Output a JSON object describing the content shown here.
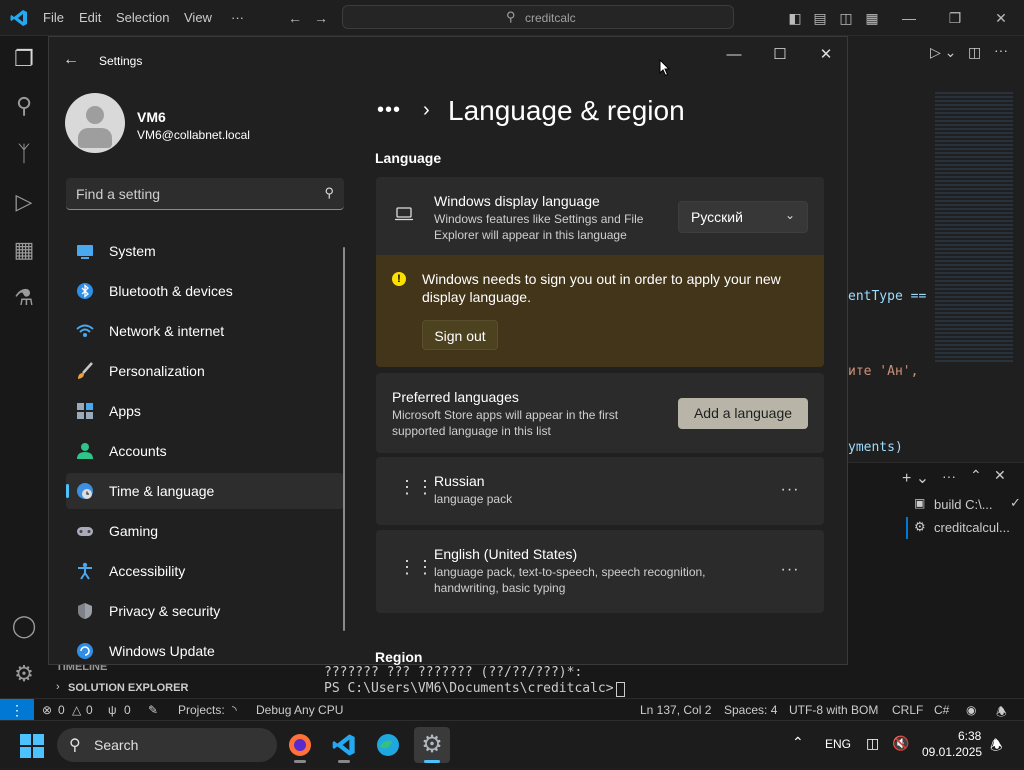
{
  "vscode": {
    "menu": [
      "File",
      "Edit",
      "Selection",
      "View",
      "···"
    ],
    "search": "creditcalc",
    "code_fragments": [
      "entType ==",
      "ите 'Aн',",
      "yments)"
    ],
    "terminal_tabs": [
      "build C:\\...",
      "creditcalcul..."
    ],
    "sidebar_sections": [
      "TIMELINE",
      "SOLUTION EXPLORER"
    ],
    "terminal_lines": [
      "??????? ??? ??????? (??/??/???)*:",
      "PS C:\\Users\\VM6\\Documents\\creditcalc> "
    ],
    "status": {
      "errors": "0",
      "warnings": "0",
      "ports": "0",
      "projects": "Projects:",
      "build_config": "Debug Any CPU",
      "cursor": "Ln 137, Col 2",
      "spaces": "Spaces: 4",
      "encoding": "UTF-8 with BOM",
      "eol": "CRLF",
      "language": "C#"
    }
  },
  "settings": {
    "app_title": "Settings",
    "user": {
      "name": "VM6",
      "email": "VM6@collabnet.local"
    },
    "find_placeholder": "Find a setting",
    "nav": [
      {
        "label": "System",
        "icon": "system-icon"
      },
      {
        "label": "Bluetooth & devices",
        "icon": "bluetooth-icon"
      },
      {
        "label": "Network & internet",
        "icon": "network-icon"
      },
      {
        "label": "Personalization",
        "icon": "brush-icon"
      },
      {
        "label": "Apps",
        "icon": "apps-icon"
      },
      {
        "label": "Accounts",
        "icon": "accounts-icon"
      },
      {
        "label": "Time & language",
        "icon": "time-language-icon",
        "selected": true
      },
      {
        "label": "Gaming",
        "icon": "gamepad-icon"
      },
      {
        "label": "Accessibility",
        "icon": "accessibility-icon"
      },
      {
        "label": "Privacy & security",
        "icon": "shield-icon"
      },
      {
        "label": "Windows Update",
        "icon": "update-icon"
      }
    ],
    "breadcrumb_more": "•••",
    "page_title": "Language & region",
    "section_language": "Language",
    "display_language": {
      "title": "Windows display language",
      "desc": "Windows features like Settings and File Explorer will appear in this language",
      "value": "Русский"
    },
    "warning": {
      "message": "Windows needs to sign you out in order to apply your new display language.",
      "button": "Sign out"
    },
    "preferred": {
      "title": "Preferred languages",
      "desc": "Microsoft Store apps will appear in the first supported language in this list",
      "button": "Add a language"
    },
    "languages": [
      {
        "name": "Russian",
        "features": "language pack"
      },
      {
        "name": "English (United States)",
        "features": "language pack, text-to-speech, speech recognition, handwriting, basic typing"
      }
    ],
    "section_region": "Region"
  },
  "taskbar": {
    "search_label": "Search",
    "tray_lang": "ENG",
    "time": "6:38",
    "date": "09.01.2025"
  },
  "colors": {
    "accent": "#4cc2ff",
    "vscode_blue": "#0078d4",
    "warning_bg": "#433519"
  }
}
